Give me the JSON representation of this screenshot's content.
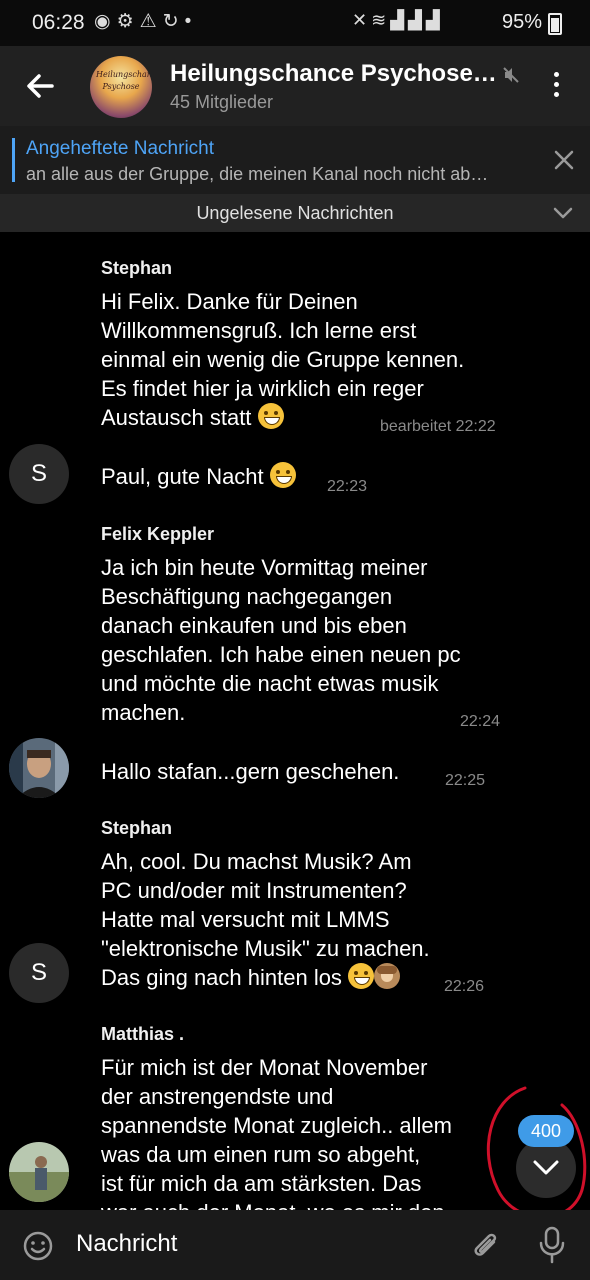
{
  "status_bar": {
    "time": "06:28",
    "battery": "95%",
    "icons": [
      "spotify-icon",
      "gear-icon",
      "warning-icon",
      "sync-icon",
      "dot-icon",
      "mute-icon",
      "wifi-icon",
      "signal-icon",
      "signal-icon",
      "signal-icon"
    ]
  },
  "header": {
    "title": "Heilungschance Psychose…",
    "subtitle": "45 Mitglieder",
    "avatar_text_line1": "Heilungschance",
    "avatar_text_line2": "Psychose"
  },
  "pinned": {
    "title": "Angeheftete Nachricht",
    "text": "an alle aus der Gruppe, die meinen Kanal noch nicht ab…"
  },
  "unread_bar": {
    "label": "Ungelesene Nachrichten"
  },
  "messages": [
    {
      "sender": "Stephan",
      "lines": [
        "Hi Felix. Danke für Deinen",
        "Willkommensgruß. Ich lerne erst",
        "einmal ein wenig die Gruppe kennen.",
        "Es findet hier ja wirklich ein reger",
        "Austausch statt"
      ],
      "time": "bearbeitet 22:22"
    },
    {
      "text": "Paul, gute Nacht",
      "time": "22:23",
      "avatar_initial": "S"
    },
    {
      "sender": "Felix Keppler",
      "lines": [
        "Ja ich bin heute Vormittag meiner",
        "Beschäftigung nachgegangen",
        "danach einkaufen und bis eben",
        "geschlafen. Ich habe einen neuen pc",
        "und möchte die nacht etwas musik",
        "machen."
      ],
      "time": "22:24"
    },
    {
      "text": "Hallo stafan...gern geschehen.",
      "time": "22:25"
    },
    {
      "sender": "Stephan",
      "lines": [
        "Ah, cool. Du machst Musik? Am",
        "PC und/oder mit Instrumenten?",
        "Hatte mal versucht mit LMMS",
        "\"elektronische Musik\" zu machen.",
        "Das ging nach hinten los"
      ],
      "time": "22:26",
      "avatar_initial": "S"
    },
    {
      "sender": "Matthias .",
      "lines": [
        "Für mich ist der Monat November",
        "der anstrengendste und",
        "spannendste Monat zugleich.. allem",
        "was da um einen rum so abgeht,",
        "ist für mich da am stärksten. Das",
        "war auch der Monat, wo es mir den"
      ]
    }
  ],
  "scroll_badge": "400",
  "input": {
    "placeholder": "Nachricht"
  },
  "colors": {
    "accent": "#4ea4f6",
    "badge": "#3f9be8",
    "annotation": "#d0102a"
  }
}
